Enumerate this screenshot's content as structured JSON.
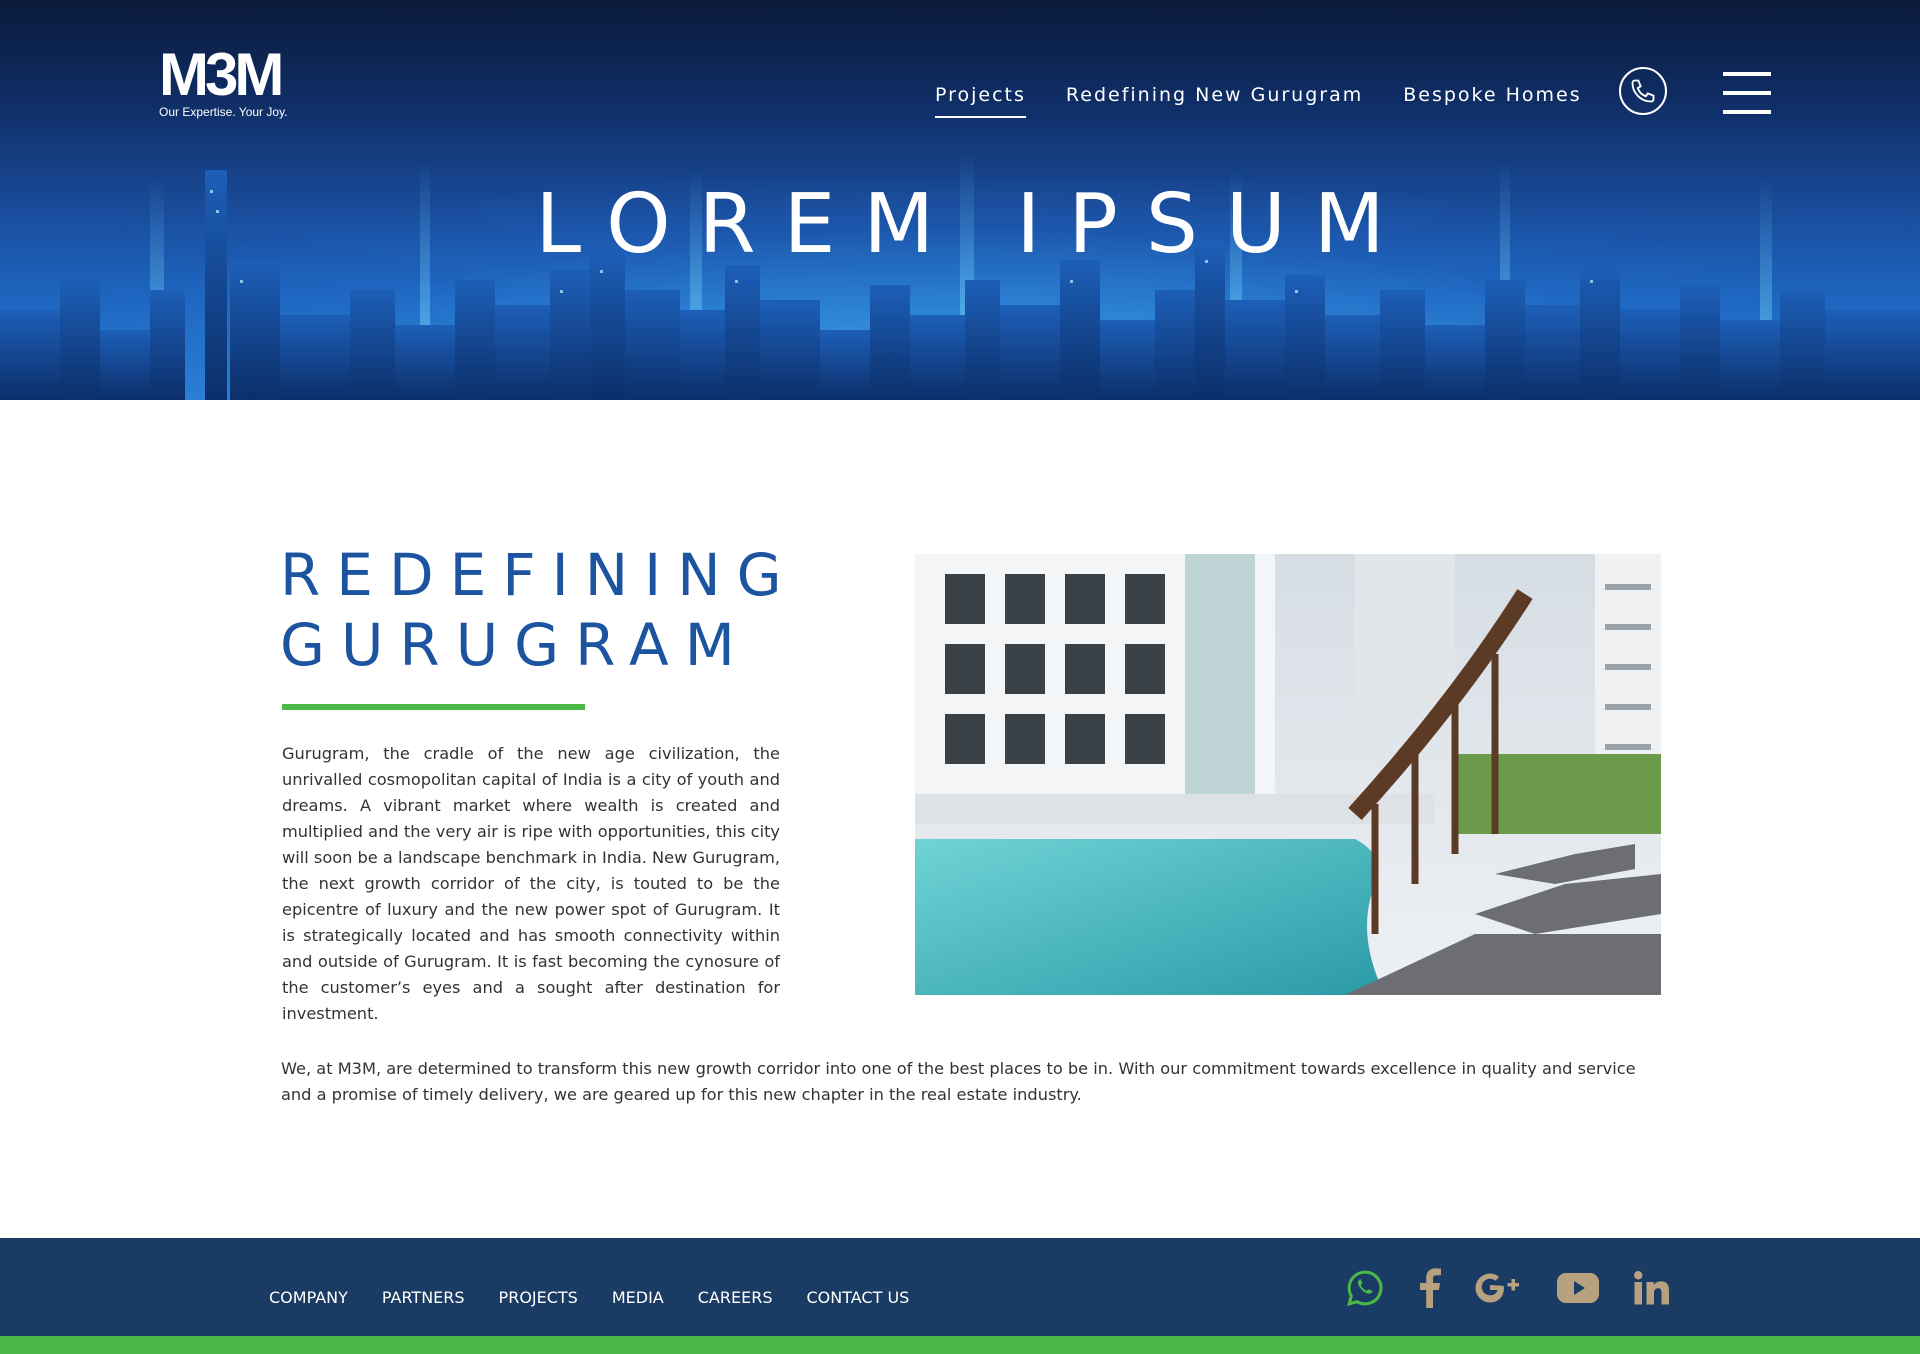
{
  "brand": {
    "logo_text": "M3M",
    "tagline": "Our Expertise. Your Joy."
  },
  "nav": {
    "items": [
      {
        "label": "Projects",
        "active": true
      },
      {
        "label": "Redefining New Gurugram",
        "active": false
      },
      {
        "label": "Bespoke Homes",
        "active": false
      }
    ],
    "phone_icon": "phone-icon",
    "menu_icon": "hamburger-menu-icon"
  },
  "hero": {
    "title": "LOREM IPSUM"
  },
  "main": {
    "title_line1": "REDEFINING",
    "title_line2": "GURUGRAM",
    "intro": "Gurugram, the cradle of the new age civilization, the unrivalled cosmopolitan capital of India is a city of youth and dreams. A vibrant market where wealth is created and multiplied and the very air is ripe with opportunities, this city will soon be a landscape benchmark in India. New Gurugram, the next growth corridor of the city, is touted to be the epicentre of luxury and the new power spot of Gurugram. It is strategically located and has smooth connectivity within and outside of Gurugram. It is fast becoming the cynosure of the customer’s eyes and a sought after destination for investment.",
    "closing": "We, at M3M, are determined to transform this new growth corridor into one of the best places to be in. With our commitment towards excellence in quality and service and a promise of timely delivery, we are geared up for this new chapter in the real estate industry."
  },
  "footer": {
    "links": [
      "COMPANY",
      "PARTNERS",
      "PROJECTS",
      "MEDIA",
      "CAREERS",
      "CONTACT US"
    ],
    "socials": [
      {
        "icon": "whatsapp-icon",
        "color": "#4cb848"
      },
      {
        "icon": "facebook-icon",
        "color": "#b8a17f"
      },
      {
        "icon": "google-plus-icon",
        "color": "#b8a17f"
      },
      {
        "icon": "youtube-icon",
        "color": "#b8a17f"
      },
      {
        "icon": "linkedin-icon",
        "color": "#b8a17f"
      }
    ]
  },
  "colors": {
    "brand_blue": "#1c54a0",
    "accent_green": "#4cb848",
    "footer_navy": "#1a3b63",
    "social_tan": "#b8a17f"
  }
}
